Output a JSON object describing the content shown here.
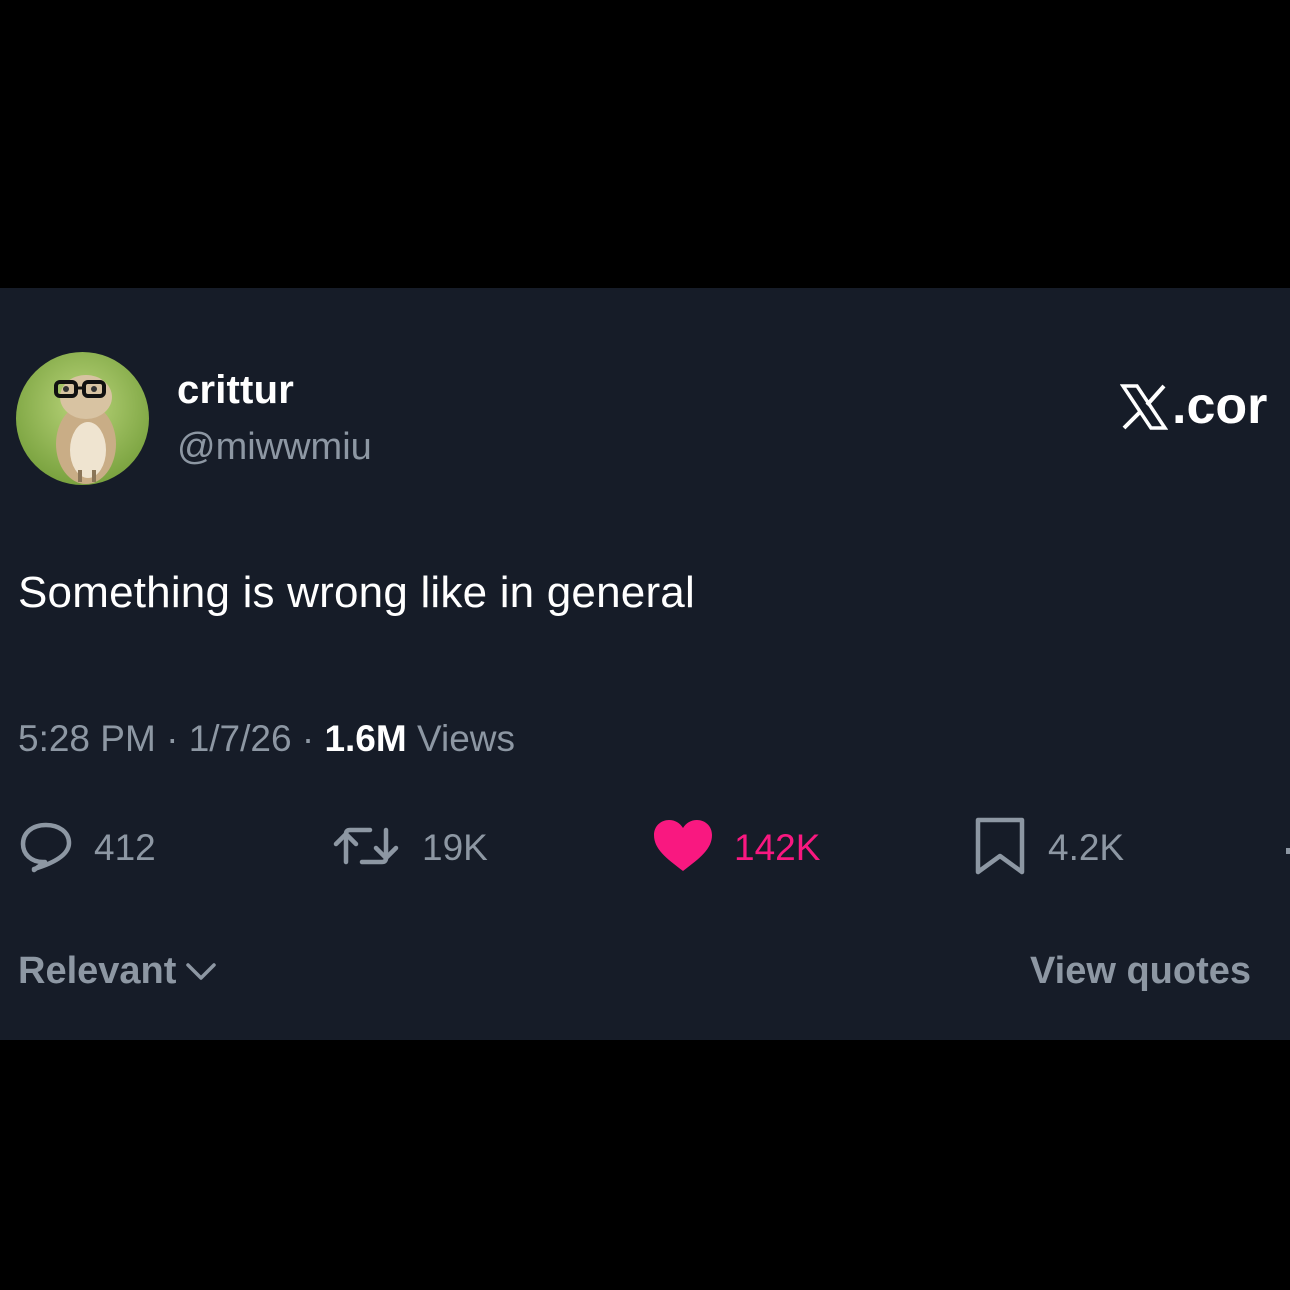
{
  "user": {
    "display_name": "crittur",
    "handle": "@miwwmiu"
  },
  "brand": {
    "text": ".cor",
    "icon": "x-logo-icon"
  },
  "tweet": {
    "text": "Something is wrong like in general"
  },
  "meta": {
    "time": "5:28 PM",
    "sep1": " · ",
    "date": "1/7/26",
    "sep2": " · ",
    "views_count": "1.6M",
    "views_label": " Views"
  },
  "actions": {
    "replies": {
      "icon": "reply-icon",
      "count": "412"
    },
    "reposts": {
      "icon": "repost-icon",
      "count": "19K"
    },
    "likes": {
      "icon": "heart-icon",
      "count": "142K",
      "liked": true
    },
    "bookmarks": {
      "icon": "bookmark-icon",
      "count": "4.2K"
    }
  },
  "footer": {
    "sort_label": "Relevant",
    "view_quotes": "View quotes"
  },
  "colors": {
    "card_background": "#161c28",
    "outer_background": "#000000",
    "muted_text": "#8d97a3",
    "like_pink": "#f91880"
  }
}
